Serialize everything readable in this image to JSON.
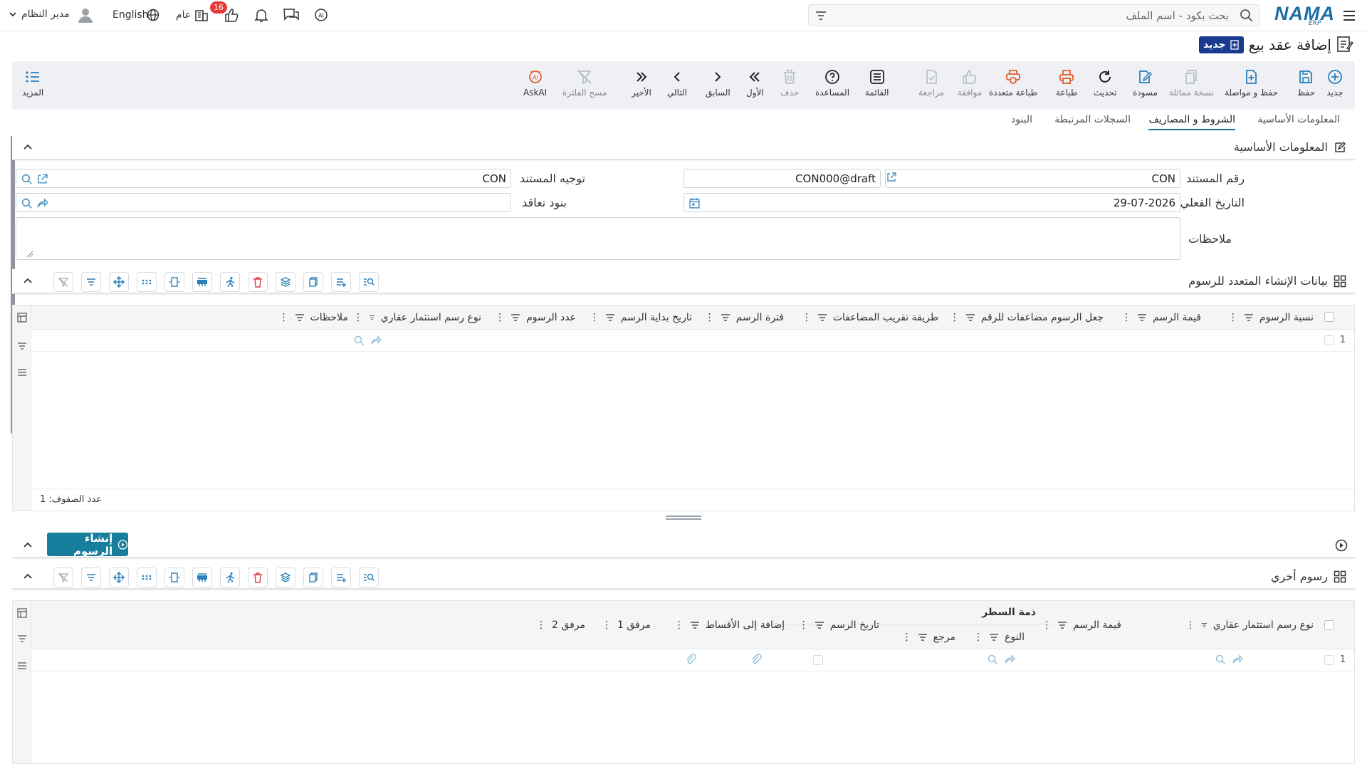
{
  "header": {
    "logo": "NAMA",
    "logo_sub": "ERP",
    "search_placeholder": "بحث بكود - اسم الملف",
    "notif_count": "16",
    "context": "عام",
    "language": "English",
    "user": "مدير النظام"
  },
  "page": {
    "title": "إضافة عقد بيع",
    "status": "جديد"
  },
  "toolbar": {
    "items": [
      {
        "label": "جديد",
        "icon": "plus-circle-icon"
      },
      {
        "label": "حفظ",
        "icon": "save-icon"
      },
      {
        "label": "حفظ و مواصلة",
        "icon": "file-plus-icon"
      },
      {
        "label": "نسخة مماثلة",
        "icon": "copy-icon"
      },
      {
        "label": "مسودة",
        "icon": "edit-icon"
      },
      {
        "label": "تحديث",
        "icon": "refresh-icon"
      },
      {
        "label": "طباعة",
        "icon": "print-icon"
      },
      {
        "label": "طباعة متعددة",
        "icon": "multi-print-icon"
      },
      {
        "label": "موافقة",
        "icon": "thumbs-up-icon"
      },
      {
        "label": "مراجعة",
        "icon": "review-icon"
      },
      {
        "label": "القائمة",
        "icon": "list-icon"
      },
      {
        "label": "المساعدة",
        "icon": "help-icon"
      },
      {
        "label": "حذف",
        "icon": "trash-icon"
      },
      {
        "label": "الأول",
        "icon": "first-icon"
      },
      {
        "label": "السابق",
        "icon": "prev-icon"
      },
      {
        "label": "التالي",
        "icon": "next-icon"
      },
      {
        "label": "الأخير",
        "icon": "last-icon"
      },
      {
        "label": "مسح الفلترة",
        "icon": "clear-filter-icon"
      },
      {
        "label": "AskAI",
        "icon": "ai-icon"
      }
    ],
    "more_label": "المزيد"
  },
  "tabs": [
    "المعلومات الأساسية",
    "الشروط و المصاريف",
    "السجلات المرتبطة",
    "البنود"
  ],
  "basic_section": {
    "title": "المعلومات الأساسية",
    "doc_number_label": "رقم المستند",
    "doc_number_prefix": "CON",
    "doc_number_value": "CON000@draft",
    "doc_direction_label": "توجيه المستند",
    "doc_direction_value": "CON",
    "actual_date_label": "التاريخ الفعلي",
    "actual_date_value": "29-07-2026",
    "contract_terms_label": "بنود تعاقد",
    "contract_terms_value": "",
    "notes_label": "ملاحظات",
    "notes_value": ""
  },
  "bulk_grid": {
    "title": "بيانات الإنشاء المتعدد للرسوم",
    "columns": [
      "نسبة الرسوم",
      "قيمة الرسم",
      "جعل الرسوم مضاعفات للرقم",
      "طريقة تقريب المضاعفات",
      "فترة الرسم",
      "تاريخ بداية الرسم",
      "عدد الرسوم",
      "نوع رسم استثمار عقاري",
      "ملاحظات"
    ],
    "rows": [
      {
        "num": "1"
      }
    ],
    "row_count_label": "عدد الصفوف: 1"
  },
  "create_fees_button": "إنشاء الرسوم",
  "other_grid": {
    "title": "رسوم أخري",
    "group_header": "ذمة السطر",
    "columns": [
      "نوع رسم استثمار عقاري",
      "قيمة الرسم",
      "النوع",
      "مرجع",
      "تاريخ الرسم",
      "إضافة إلى الأقساط",
      "مرفق 1",
      "مرفق 2"
    ],
    "rows": [
      {
        "num": "1"
      }
    ]
  }
}
